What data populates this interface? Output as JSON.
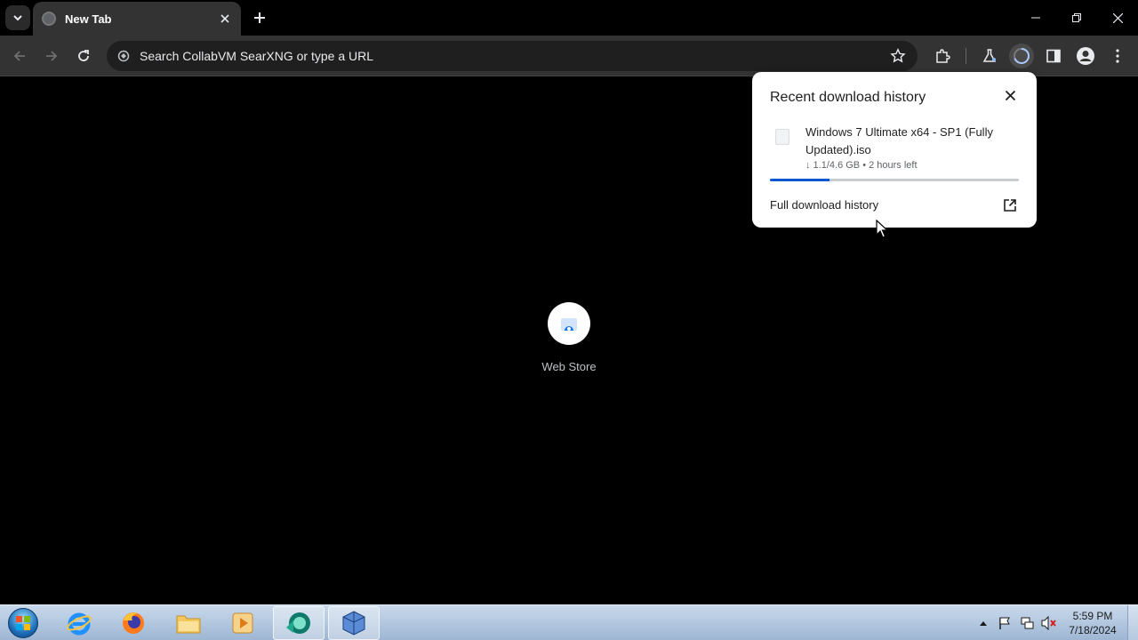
{
  "browser": {
    "tab": {
      "title": "New Tab"
    },
    "omnibox": {
      "placeholder": "Search CollabVM SearXNG or type a URL"
    }
  },
  "new_tab_page": {
    "shortcuts": [
      {
        "label": "Web Store"
      }
    ]
  },
  "download_panel": {
    "heading": "Recent download history",
    "item": {
      "filename": "Windows 7 Ultimate x64 - SP1 (Fully Updated).iso",
      "status": "↓ 1.1/4.6 GB • 2 hours left",
      "progress_fraction": 0.24
    },
    "full_history_label": "Full download history"
  },
  "taskbar": {
    "apps": [
      "internet-explorer",
      "firefox",
      "file-explorer",
      "media-player",
      "browser-active",
      "virtualbox"
    ],
    "clock": {
      "time": "5:59 PM",
      "date": "7/18/2024"
    }
  },
  "colors": {
    "accent": "#0b57d0",
    "toolbar": "#333333",
    "page_background": "#000000"
  }
}
